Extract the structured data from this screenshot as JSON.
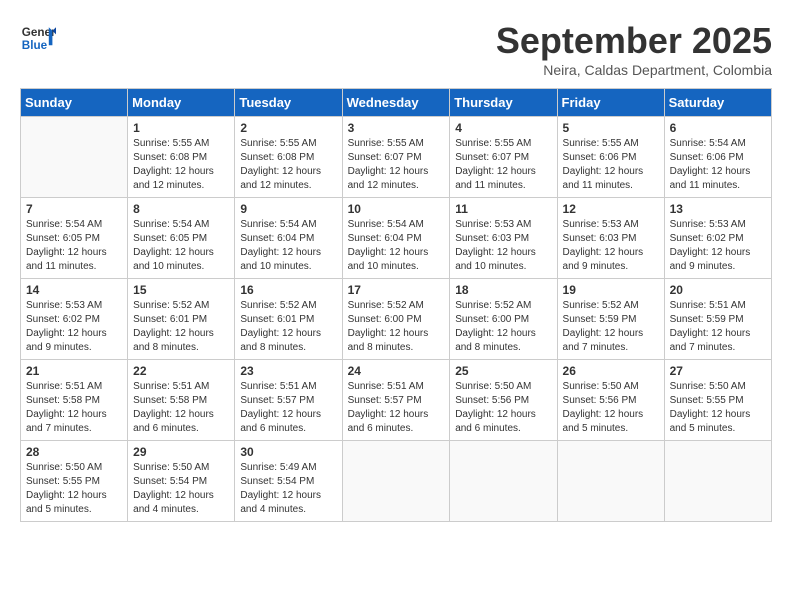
{
  "header": {
    "logo_line1": "General",
    "logo_line2": "Blue",
    "month": "September 2025",
    "location": "Neira, Caldas Department, Colombia"
  },
  "weekdays": [
    "Sunday",
    "Monday",
    "Tuesday",
    "Wednesday",
    "Thursday",
    "Friday",
    "Saturday"
  ],
  "weeks": [
    [
      {
        "day": "",
        "info": ""
      },
      {
        "day": "1",
        "info": "Sunrise: 5:55 AM\nSunset: 6:08 PM\nDaylight: 12 hours\nand 12 minutes."
      },
      {
        "day": "2",
        "info": "Sunrise: 5:55 AM\nSunset: 6:08 PM\nDaylight: 12 hours\nand 12 minutes."
      },
      {
        "day": "3",
        "info": "Sunrise: 5:55 AM\nSunset: 6:07 PM\nDaylight: 12 hours\nand 12 minutes."
      },
      {
        "day": "4",
        "info": "Sunrise: 5:55 AM\nSunset: 6:07 PM\nDaylight: 12 hours\nand 11 minutes."
      },
      {
        "day": "5",
        "info": "Sunrise: 5:55 AM\nSunset: 6:06 PM\nDaylight: 12 hours\nand 11 minutes."
      },
      {
        "day": "6",
        "info": "Sunrise: 5:54 AM\nSunset: 6:06 PM\nDaylight: 12 hours\nand 11 minutes."
      }
    ],
    [
      {
        "day": "7",
        "info": "Sunrise: 5:54 AM\nSunset: 6:05 PM\nDaylight: 12 hours\nand 11 minutes."
      },
      {
        "day": "8",
        "info": "Sunrise: 5:54 AM\nSunset: 6:05 PM\nDaylight: 12 hours\nand 10 minutes."
      },
      {
        "day": "9",
        "info": "Sunrise: 5:54 AM\nSunset: 6:04 PM\nDaylight: 12 hours\nand 10 minutes."
      },
      {
        "day": "10",
        "info": "Sunrise: 5:54 AM\nSunset: 6:04 PM\nDaylight: 12 hours\nand 10 minutes."
      },
      {
        "day": "11",
        "info": "Sunrise: 5:53 AM\nSunset: 6:03 PM\nDaylight: 12 hours\nand 10 minutes."
      },
      {
        "day": "12",
        "info": "Sunrise: 5:53 AM\nSunset: 6:03 PM\nDaylight: 12 hours\nand 9 minutes."
      },
      {
        "day": "13",
        "info": "Sunrise: 5:53 AM\nSunset: 6:02 PM\nDaylight: 12 hours\nand 9 minutes."
      }
    ],
    [
      {
        "day": "14",
        "info": "Sunrise: 5:53 AM\nSunset: 6:02 PM\nDaylight: 12 hours\nand 9 minutes."
      },
      {
        "day": "15",
        "info": "Sunrise: 5:52 AM\nSunset: 6:01 PM\nDaylight: 12 hours\nand 8 minutes."
      },
      {
        "day": "16",
        "info": "Sunrise: 5:52 AM\nSunset: 6:01 PM\nDaylight: 12 hours\nand 8 minutes."
      },
      {
        "day": "17",
        "info": "Sunrise: 5:52 AM\nSunset: 6:00 PM\nDaylight: 12 hours\nand 8 minutes."
      },
      {
        "day": "18",
        "info": "Sunrise: 5:52 AM\nSunset: 6:00 PM\nDaylight: 12 hours\nand 8 minutes."
      },
      {
        "day": "19",
        "info": "Sunrise: 5:52 AM\nSunset: 5:59 PM\nDaylight: 12 hours\nand 7 minutes."
      },
      {
        "day": "20",
        "info": "Sunrise: 5:51 AM\nSunset: 5:59 PM\nDaylight: 12 hours\nand 7 minutes."
      }
    ],
    [
      {
        "day": "21",
        "info": "Sunrise: 5:51 AM\nSunset: 5:58 PM\nDaylight: 12 hours\nand 7 minutes."
      },
      {
        "day": "22",
        "info": "Sunrise: 5:51 AM\nSunset: 5:58 PM\nDaylight: 12 hours\nand 6 minutes."
      },
      {
        "day": "23",
        "info": "Sunrise: 5:51 AM\nSunset: 5:57 PM\nDaylight: 12 hours\nand 6 minutes."
      },
      {
        "day": "24",
        "info": "Sunrise: 5:51 AM\nSunset: 5:57 PM\nDaylight: 12 hours\nand 6 minutes."
      },
      {
        "day": "25",
        "info": "Sunrise: 5:50 AM\nSunset: 5:56 PM\nDaylight: 12 hours\nand 6 minutes."
      },
      {
        "day": "26",
        "info": "Sunrise: 5:50 AM\nSunset: 5:56 PM\nDaylight: 12 hours\nand 5 minutes."
      },
      {
        "day": "27",
        "info": "Sunrise: 5:50 AM\nSunset: 5:55 PM\nDaylight: 12 hours\nand 5 minutes."
      }
    ],
    [
      {
        "day": "28",
        "info": "Sunrise: 5:50 AM\nSunset: 5:55 PM\nDaylight: 12 hours\nand 5 minutes."
      },
      {
        "day": "29",
        "info": "Sunrise: 5:50 AM\nSunset: 5:54 PM\nDaylight: 12 hours\nand 4 minutes."
      },
      {
        "day": "30",
        "info": "Sunrise: 5:49 AM\nSunset: 5:54 PM\nDaylight: 12 hours\nand 4 minutes."
      },
      {
        "day": "",
        "info": ""
      },
      {
        "day": "",
        "info": ""
      },
      {
        "day": "",
        "info": ""
      },
      {
        "day": "",
        "info": ""
      }
    ]
  ]
}
